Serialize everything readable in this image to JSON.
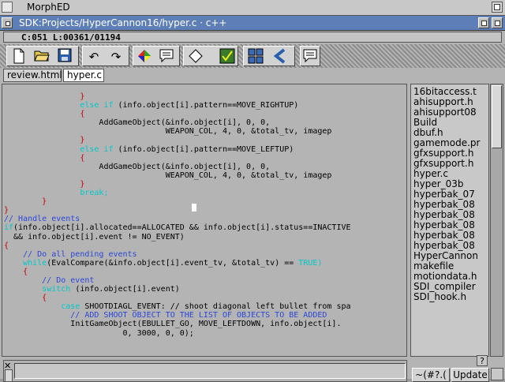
{
  "screen": {
    "title": "MorphED"
  },
  "window": {
    "title": "SDK:Projects/HyperCannon16/hyper.c · c++"
  },
  "status": {
    "text": "C:051 L:00361/01194"
  },
  "tabs": [
    {
      "label": "review.html",
      "active": false
    },
    {
      "label": "hyper.c",
      "active": true
    }
  ],
  "toolbar": {
    "icons": [
      "new-file-icon",
      "open-folder-icon",
      "save-disk-icon",
      "undo-icon",
      "redo-icon",
      "color-diamond-icon",
      "comment-icon",
      "shape-diamond-icon",
      "check-icon",
      "grid-icon",
      "arrow-icon",
      "note-icon"
    ]
  },
  "colors": {
    "keyword": "#00c8c8",
    "comment": "#2c47d8",
    "brace": "#c80000",
    "title_bar": "#5d7eb6"
  },
  "code": {
    "l1": [
      "",
      "                ",
      "}",
      "",
      ""
    ],
    "l2": [
      "",
      "                ",
      "else if",
      " (info.object[i].pattern==MOVE_RIGHTUP)",
      ""
    ],
    "l3": [
      "",
      "                ",
      "{",
      "",
      ""
    ],
    "l4": [
      "",
      "                    ",
      "",
      "AddGameObject(&info.object[i], 0, 0,",
      ""
    ],
    "l5": [
      "",
      "                                  ",
      "",
      "WEAPON_COL, 4, 0, &total_tv, imagep",
      ""
    ],
    "l6": [
      "",
      "                ",
      "}",
      "",
      ""
    ],
    "l7": [
      "",
      "                ",
      "else if",
      " (info.object[i].pattern==MOVE_LEFTUP)",
      ""
    ],
    "l8": [
      "",
      "                ",
      "{",
      "",
      ""
    ],
    "l9": [
      "",
      "                    ",
      "",
      "AddGameObject(&info.object[i], 0, 0,",
      ""
    ],
    "l10": [
      "",
      "                                  ",
      "",
      "WEAPON_COL, 4, 0, &total_tv, imagep",
      ""
    ],
    "l11": [
      "",
      "                ",
      "}",
      "",
      ""
    ],
    "l12": [
      "",
      "                ",
      "",
      "",
      "break;"
    ],
    "l13": [
      "",
      "        ",
      "}",
      "",
      ""
    ],
    "l14": [
      "",
      "",
      "}",
      "",
      ""
    ],
    "l15": [
      "",
      "",
      "",
      "",
      ""
    ],
    "l16": [
      "// Handle events",
      "",
      "",
      "",
      ""
    ],
    "l17": [
      "",
      "",
      "if",
      "(info.object[i].allocated==ALLOCATED && info.object[i].status==INACTIVE",
      ""
    ],
    "l18": [
      "",
      "",
      "",
      "  && info.object[i].event != NO_EVENT)",
      ""
    ],
    "l19": [
      "",
      "",
      "{",
      "",
      ""
    ],
    "l20": [
      "    // Do all pending events",
      "",
      "",
      "",
      ""
    ],
    "l21": [
      "",
      "    ",
      "while",
      "(EvalCompare(&info.object[i].event_tv, &total_tv) == ",
      "TRUE)"
    ],
    "l22": [
      "",
      "    ",
      "{",
      "",
      ""
    ],
    "l23": [
      "        // Do event",
      "",
      "",
      "",
      ""
    ],
    "l24": [
      "",
      "        ",
      "switch",
      " (info.object[i].event)",
      ""
    ],
    "l25": [
      "",
      "        ",
      "{",
      "",
      ""
    ],
    "l26": [
      "",
      "            ",
      "case",
      " SHOOTDIAGL_EVENT: // shoot diagonal left bullet from spa",
      ""
    ],
    "l27": [
      "              // ADD SHOOT OBJECT TO THE LIST OF OBJECTS TO BE ADDED",
      "",
      "",
      "",
      ""
    ],
    "l28": [
      "",
      "              ",
      "",
      "InitGameObject(EBULLET_GO, MOVE_LEFTDOWN, info.object[i].",
      ""
    ],
    "l29": [
      "",
      "                         ",
      "",
      "0, 3000, 0, 0);",
      ""
    ]
  },
  "files": [
    "16bitaccess.t",
    "ahisupport.h",
    "ahisupport08",
    "Build",
    "dbuf.h",
    "gamemode.pr",
    "gfxsupport.h",
    "gfxsupport.h",
    "hyper.c",
    "hyper_03b",
    "hyperbak_07",
    "hyperbak_08",
    "hyperbak_08",
    "hyperbak_08",
    "hyperbak_08",
    "hyperbak_08",
    "HyperCannon",
    "makefile",
    "motiondata.h",
    "SDI_compiler",
    "SDI_hook.h"
  ],
  "buttons": {
    "filter": "~(#?.(",
    "update": "Update",
    "help": "?"
  }
}
